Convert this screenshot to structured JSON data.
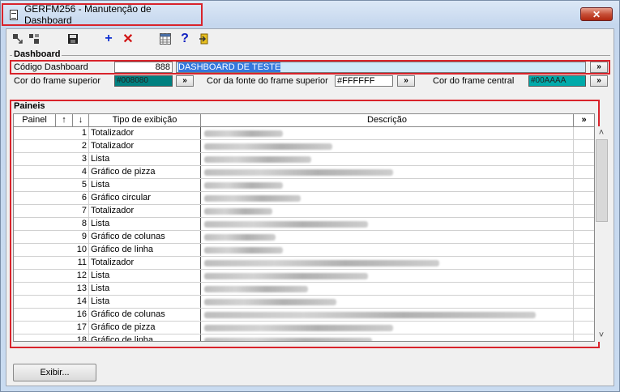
{
  "window": {
    "title": "GERFM256 - Manutenção de Dashboard",
    "close_glyph": "✕"
  },
  "toolbar": {
    "add_glyph": "+",
    "delete_glyph": "✕",
    "help_glyph": "?"
  },
  "dashboard": {
    "section_label": "Dashboard",
    "codigo_label": "Código Dashboard",
    "codigo_value": "888",
    "nome_value": "DASHBOARD DE TESTE",
    "more_glyph": "»",
    "cor_frame_superior_label": "Cor do frame superior",
    "cor_frame_superior_value": "#008080",
    "cor_fonte_label": "Cor da fonte do frame superior",
    "cor_fonte_value": "#FFFFFF",
    "cor_frame_central_label": "Cor do frame central",
    "cor_frame_central_value": "#00AAAA",
    "colors": {
      "frame_superior": "#008080",
      "fonte": "#FFFFFF",
      "frame_central": "#00AAAA"
    }
  },
  "paineis": {
    "section_label": "Paineis",
    "columns": {
      "painel": "Painel",
      "up": "↑",
      "down": "↓",
      "tipo": "Tipo de exibição",
      "descricao": "Descrição",
      "more": "»"
    },
    "rows": [
      {
        "num": "1",
        "tipo": "Totalizador",
        "desc_len": 0.22
      },
      {
        "num": "2",
        "tipo": "Totalizador",
        "desc_len": 0.36
      },
      {
        "num": "3",
        "tipo": "Lista",
        "desc_len": 0.3
      },
      {
        "num": "4",
        "tipo": "Gráfico de pizza",
        "desc_len": 0.53
      },
      {
        "num": "5",
        "tipo": "Lista",
        "desc_len": 0.22
      },
      {
        "num": "6",
        "tipo": "Gráfico circular",
        "desc_len": 0.27
      },
      {
        "num": "7",
        "tipo": "Totalizador",
        "desc_len": 0.19
      },
      {
        "num": "8",
        "tipo": "Lista",
        "desc_len": 0.46
      },
      {
        "num": "9",
        "tipo": "Gráfico de colunas",
        "desc_len": 0.2
      },
      {
        "num": "10",
        "tipo": "Gráfico de linha",
        "desc_len": 0.22
      },
      {
        "num": "11",
        "tipo": "Totalizador",
        "desc_len": 0.66
      },
      {
        "num": "12",
        "tipo": "Lista",
        "desc_len": 0.46
      },
      {
        "num": "13",
        "tipo": "Lista",
        "desc_len": 0.29
      },
      {
        "num": "14",
        "tipo": "Lista",
        "desc_len": 0.37
      },
      {
        "num": "16",
        "tipo": "Gráfico de colunas",
        "desc_len": 0.93
      },
      {
        "num": "17",
        "tipo": "Gráfico de pizza",
        "desc_len": 0.53
      },
      {
        "num": "18",
        "tipo": "Gráfico de linha",
        "desc_len": 0.47
      }
    ]
  },
  "footer": {
    "exibir_label": "Exibir..."
  }
}
